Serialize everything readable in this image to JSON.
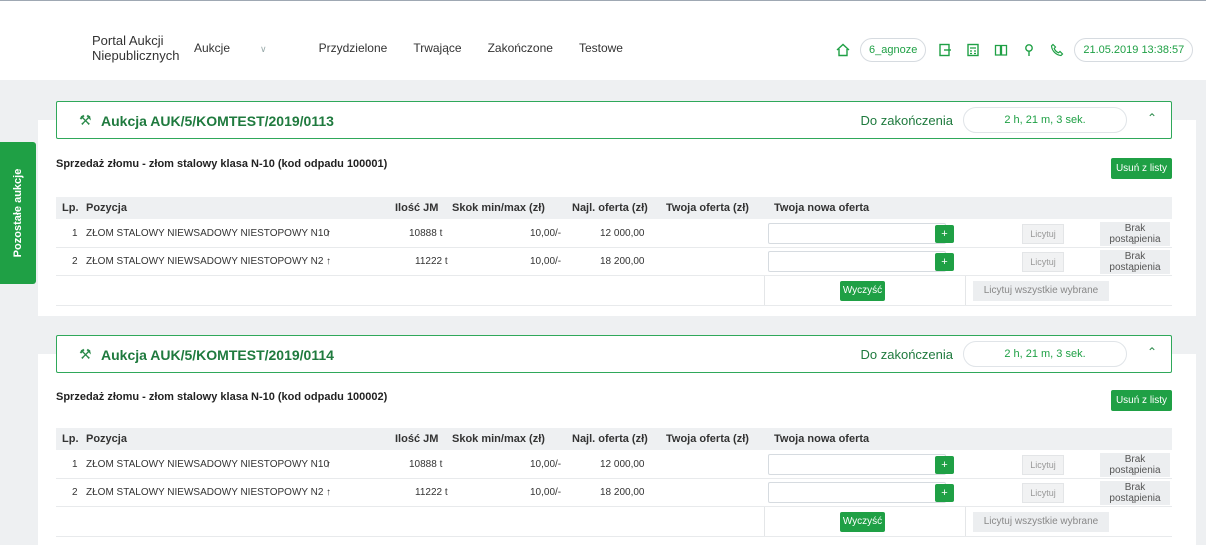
{
  "header": {
    "brand": [
      "Portal Aukcji",
      "Niepublicznych"
    ],
    "nav": [
      {
        "label": "Aukcje",
        "has_caret": true
      },
      {
        "label": "Przydzielone"
      },
      {
        "label": "Trwające"
      },
      {
        "label": "Zakończone"
      },
      {
        "label": "Testowe"
      }
    ],
    "user": "6_agnoze",
    "datetime": "21.05.2019 13:38:57",
    "icons": [
      "home-icon",
      "logout-icon",
      "calculator-icon",
      "book-icon",
      "help-icon",
      "phone-icon"
    ]
  },
  "sidebar_tab": "Pozostałe aukcje",
  "columns": {
    "lp": "Lp.",
    "pozycja": "Pozycja",
    "ilosc": "Ilość JM",
    "skok": "Skok min/max (zł)",
    "najl": "Najl. oferta (zł)",
    "twoja": "Twoja oferta (zł)",
    "nowa": "Twoja nowa oferta"
  },
  "auctions": [
    {
      "title": "Aukcja AUK/5/KOMTEST/2019/0113",
      "countdown_label": "Do zakończenia",
      "countdown": "2 h, 21 m, 3 sek.",
      "subtitle": "Sprzedaż złomu - złom stalowy klasa N-10 (kod odpadu 100001)",
      "remove_label": "Usuń z listy",
      "rows": [
        {
          "lp": "1",
          "pozycja": "ZŁOM STALOWY NIEWSADOWY NIESTOPOWY N10",
          "ilosc": "10888 t",
          "skok": "10,00/-",
          "najl": "12 000,00",
          "twoja": "",
          "bid_label": "Licytuj",
          "brak": [
            "Brak",
            "postąpienia"
          ]
        },
        {
          "lp": "2",
          "pozycja": "ZŁOM STALOWY NIEWSADOWY NIESTOPOWY N2",
          "ilosc": "11222 t",
          "skok": "10,00/-",
          "najl": "18 200,00",
          "twoja": "",
          "bid_label": "Licytuj",
          "brak": [
            "Brak",
            "postąpienia"
          ]
        }
      ],
      "clear_label": "Wyczyść",
      "bid_all_label": "Licytuj wszystkie wybrane"
    },
    {
      "title": "Aukcja AUK/5/KOMTEST/2019/0114",
      "countdown_label": "Do zakończenia",
      "countdown": "2 h, 21 m, 3 sek.",
      "subtitle": "Sprzedaż złomu - złom stalowy klasa N-10 (kod odpadu 100002)",
      "remove_label": "Usuń z listy",
      "rows": [
        {
          "lp": "1",
          "pozycja": "ZŁOM STALOWY NIEWSADOWY NIESTOPOWY N10",
          "ilosc": "10888 t",
          "skok": "10,00/-",
          "najl": "12 000,00",
          "twoja": "",
          "bid_label": "Licytuj",
          "brak": [
            "Brak",
            "postąpienia"
          ]
        },
        {
          "lp": "2",
          "pozycja": "ZŁOM STALOWY NIEWSADOWY NIESTOPOWY N2",
          "ilosc": "11222 t",
          "skok": "10,00/-",
          "najl": "18 200,00",
          "twoja": "",
          "bid_label": "Licytuj",
          "brak": [
            "Brak",
            "postąpienia"
          ]
        }
      ],
      "clear_label": "Wyczyść",
      "bid_all_label": "Licytuj wszystkie wybrane"
    }
  ],
  "colors": {
    "accent": "#1fa045",
    "title": "#1f7a3e"
  }
}
